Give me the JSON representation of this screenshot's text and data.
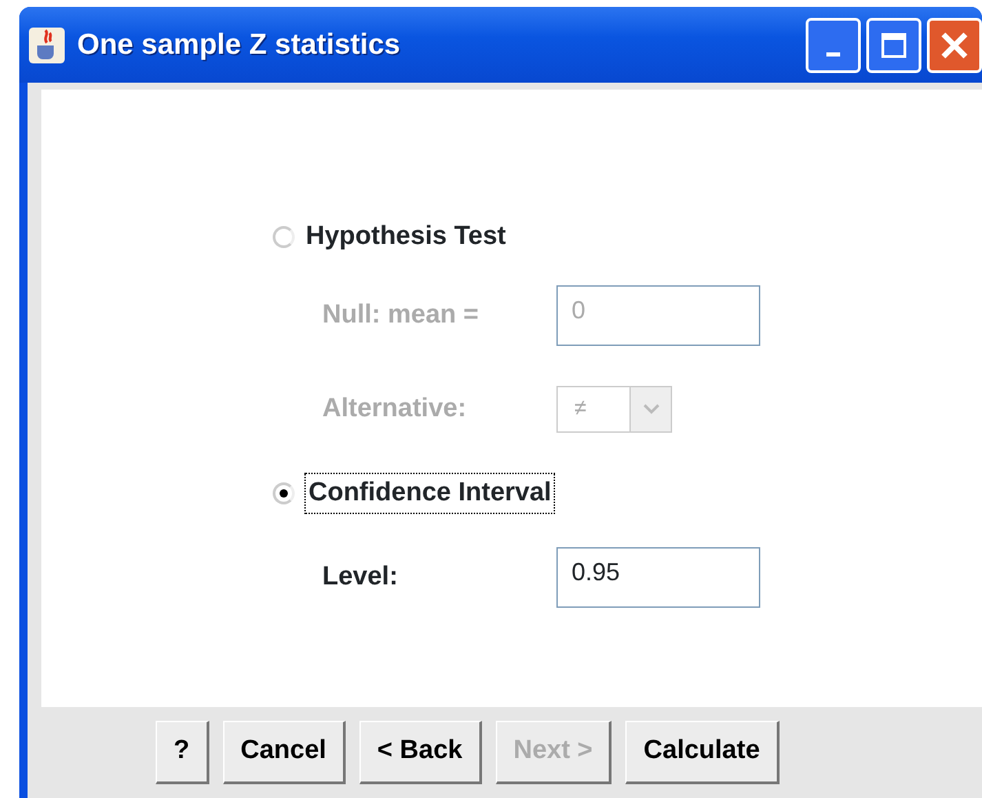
{
  "window": {
    "title": "One sample Z statistics"
  },
  "hypothesis": {
    "label": "Hypothesis Test",
    "selected": false,
    "disabled": true,
    "null_label": "Null: mean =",
    "null_value": "0",
    "alternative_label": "Alternative:",
    "alternative_value": "≠"
  },
  "interval": {
    "label": "Confidence Interval",
    "selected": true,
    "focused": true,
    "level_label": "Level:",
    "level_value": "0.95"
  },
  "buttons": [
    {
      "label": "?",
      "disabled": false
    },
    {
      "label": "Cancel",
      "disabled": false
    },
    {
      "label": "< Back",
      "disabled": false
    },
    {
      "label": "Next >",
      "disabled": true
    },
    {
      "label": "Calculate",
      "disabled": false
    }
  ]
}
